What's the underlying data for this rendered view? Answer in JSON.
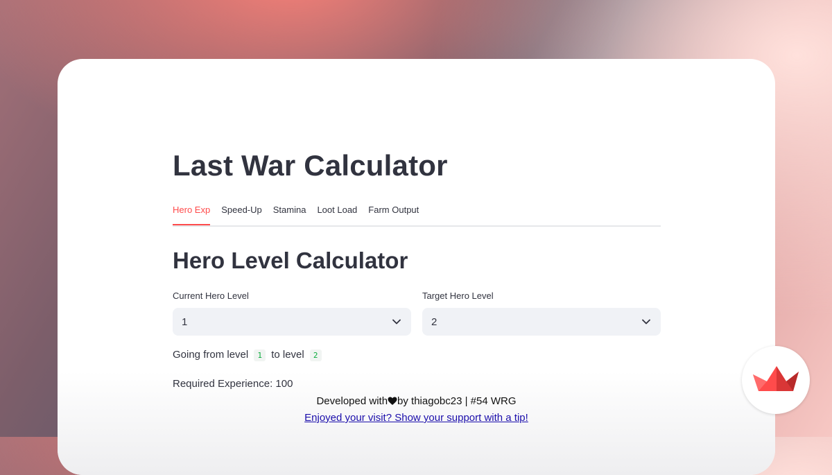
{
  "app": {
    "title": "Last War Calculator",
    "accent_color": "#ff4b4b"
  },
  "tabs": [
    {
      "label": "Hero Exp",
      "active": true
    },
    {
      "label": "Speed-Up",
      "active": false
    },
    {
      "label": "Stamina",
      "active": false
    },
    {
      "label": "Loot Load",
      "active": false
    },
    {
      "label": "Farm Output",
      "active": false
    }
  ],
  "main": {
    "heading": "Hero Level Calculator",
    "current_level": {
      "label": "Current Hero Level",
      "value": "1",
      "icon": "chevron-down-icon"
    },
    "target_level": {
      "label": "Target Hero Level",
      "value": "2",
      "icon": "chevron-down-icon"
    },
    "going": {
      "prefix": "Going from level",
      "from": "1",
      "middle": "to level",
      "to": "2"
    },
    "required": "Required Experience: 100"
  },
  "footer": {
    "dev_prefix": "Developed with",
    "heart_icon": "heart-icon",
    "dev_suffix": "by thiagobc23 | #54 WRG",
    "tip_link": "Enjoyed your visit? Show your support with a tip!"
  },
  "badge": {
    "icon": "streamlit-crown-icon",
    "color": "#ff4b4b"
  }
}
